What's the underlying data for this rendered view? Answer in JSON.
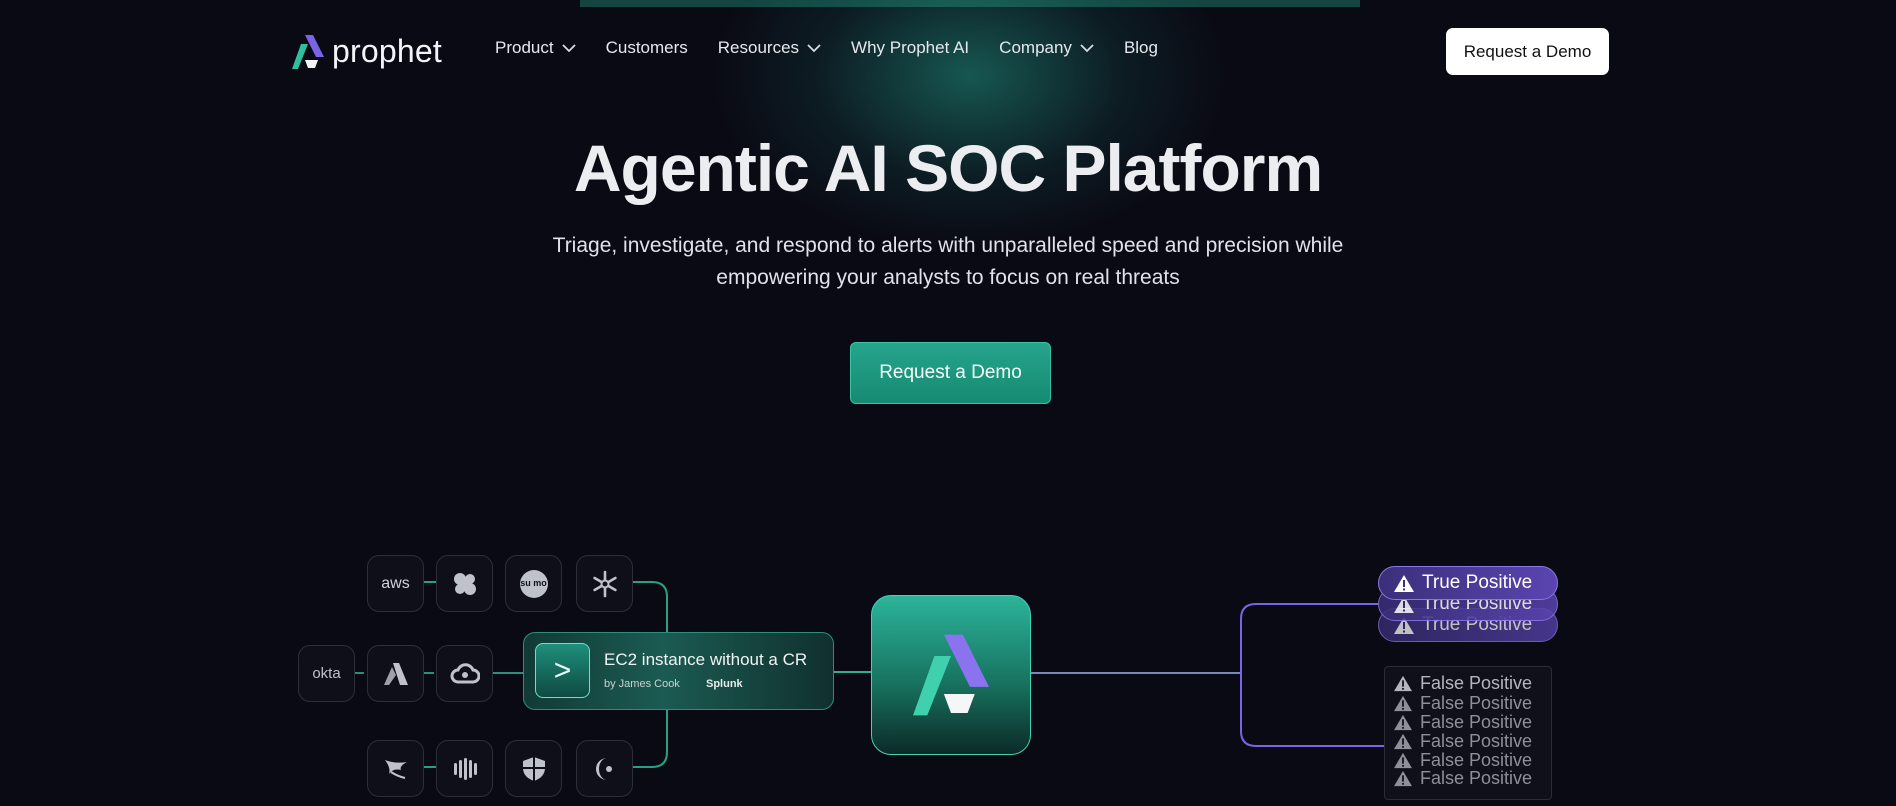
{
  "brand": {
    "name": "prophet",
    "accent": "#21a48a",
    "purple": "#7b63e6"
  },
  "nav": {
    "items": [
      {
        "label": "Product",
        "has_dropdown": true
      },
      {
        "label": "Customers",
        "has_dropdown": false
      },
      {
        "label": "Resources",
        "has_dropdown": true
      },
      {
        "label": "Why Prophet AI",
        "has_dropdown": false
      },
      {
        "label": "Company",
        "has_dropdown": true
      },
      {
        "label": "Blog",
        "has_dropdown": false
      }
    ],
    "cta_label": "Request a Demo"
  },
  "hero": {
    "title": "Agentic AI SOC Platform",
    "subtitle_line1": "Triage, investigate, and respond to alerts with unparalleled speed and precision while",
    "subtitle_line2": "empowering your analysts to focus on real threats",
    "cta_label": "Request a Demo"
  },
  "integrations": {
    "row1": [
      "aws-icon",
      "cluster-icon",
      "sumo-icon",
      "snowflake-icon"
    ],
    "row2_labels": {
      "okta": "okta",
      "aws_logo": "aws",
      "sumo": "su mo"
    },
    "row2": [
      "okta-icon",
      "azure-icon",
      "cloud-icon"
    ],
    "row3": [
      "falcon-icon",
      "pipes-icon",
      "shield-icon",
      "crescent-icon"
    ]
  },
  "alert": {
    "title": "EC2 instance without a CR",
    "by": "by James Cook",
    "source": "Splunk",
    "icon_glyph": ">"
  },
  "verdicts": {
    "true_positive": "True Positive",
    "false_positive": "False Positive"
  }
}
